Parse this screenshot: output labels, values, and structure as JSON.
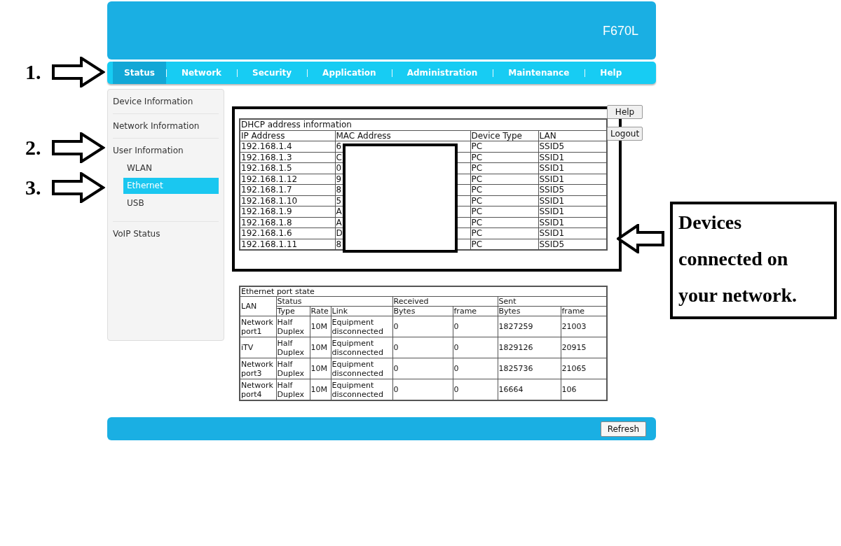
{
  "header": {
    "model": "F670L"
  },
  "nav": [
    {
      "label": "Status",
      "selected": true
    },
    {
      "label": "Network",
      "selected": false
    },
    {
      "label": "Security",
      "selected": false
    },
    {
      "label": "Application",
      "selected": false
    },
    {
      "label": "Administration",
      "selected": false
    },
    {
      "label": "Maintenance",
      "selected": false
    },
    {
      "label": "Help",
      "selected": false
    }
  ],
  "sidebar": [
    {
      "label": "Device Information",
      "selected": false
    },
    {
      "label": "Network Information",
      "selected": false
    },
    {
      "label": "User Information",
      "selected": false,
      "children": [
        {
          "label": "WLAN",
          "selected": false
        },
        {
          "label": "Ethernet",
          "selected": true
        },
        {
          "label": "USB",
          "selected": false
        }
      ]
    },
    {
      "label": "VoIP Status",
      "selected": false
    }
  ],
  "dhcp": {
    "title": "DHCP address information",
    "columns": [
      "IP Address",
      "MAC Address",
      "Device Type",
      "LAN"
    ],
    "rows": [
      {
        "ip": "192.168.1.4",
        "mac": "6",
        "type": "PC",
        "lan": "SSID5"
      },
      {
        "ip": "192.168.1.3",
        "mac": "C",
        "type": "PC",
        "lan": "SSID1"
      },
      {
        "ip": "192.168.1.5",
        "mac": "0",
        "type": "PC",
        "lan": "SSID1"
      },
      {
        "ip": "192.168.1.12",
        "mac": "9",
        "type": "PC",
        "lan": "SSID1"
      },
      {
        "ip": "192.168.1.7",
        "mac": "8",
        "type": "PC",
        "lan": "SSID5"
      },
      {
        "ip": "192.168.1.10",
        "mac": "5",
        "type": "PC",
        "lan": "SSID1"
      },
      {
        "ip": "192.168.1.9",
        "mac": "A",
        "type": "PC",
        "lan": "SSID1"
      },
      {
        "ip": "192.168.1.8",
        "mac": "A",
        "type": "PC",
        "lan": "SSID1"
      },
      {
        "ip": "192.168.1.6",
        "mac": "D",
        "type": "PC",
        "lan": "SSID1"
      },
      {
        "ip": "192.168.1.11",
        "mac": "8",
        "type": "PC",
        "lan": "SSID5"
      }
    ]
  },
  "side_buttons": [
    "Help",
    "Logout"
  ],
  "ethernet": {
    "title": "Ethernet port state",
    "lan_header": "LAN",
    "groups": [
      "Status",
      "Received",
      "Sent"
    ],
    "columns": [
      "Type",
      "Rate",
      "Link",
      "Bytes",
      "frame",
      "Bytes",
      "frame"
    ],
    "rows": [
      {
        "lan": "Network port1",
        "type": "Half Duplex",
        "rate": "10M",
        "link": "Equipment disconnected",
        "rx_bytes": "0",
        "rx_frame": "0",
        "tx_bytes": "1827259",
        "tx_frame": "21003"
      },
      {
        "lan": "iTV",
        "type": "Half Duplex",
        "rate": "10M",
        "link": "Equipment disconnected",
        "rx_bytes": "0",
        "rx_frame": "0",
        "tx_bytes": "1829126",
        "tx_frame": "20915"
      },
      {
        "lan": "Network port3",
        "type": "Half Duplex",
        "rate": "10M",
        "link": "Equipment disconnected",
        "rx_bytes": "0",
        "rx_frame": "0",
        "tx_bytes": "1825736",
        "tx_frame": "21065"
      },
      {
        "lan": "Network port4",
        "type": "Half Duplex",
        "rate": "10M",
        "link": "Equipment disconnected",
        "rx_bytes": "0",
        "rx_frame": "0",
        "tx_bytes": "16664",
        "tx_frame": "106"
      }
    ]
  },
  "footer": {
    "button": "Refresh"
  },
  "annotations": {
    "steps": [
      "1.",
      "2.",
      "3."
    ],
    "callout": [
      "Devices",
      "connected on",
      "your network."
    ]
  }
}
